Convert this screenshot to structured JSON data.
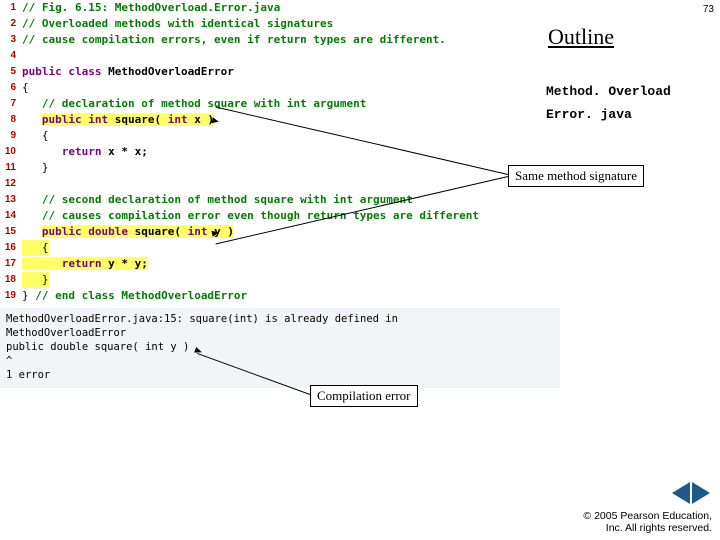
{
  "page_number": "73",
  "outline": "Outline",
  "label_line1": "Method. Overload",
  "label_line2": "Error. java",
  "callout1": "Same method signature",
  "callout2": "Compilation error",
  "footer_line1": "© 2005 Pearson Education,",
  "footer_line2": "Inc.  All rights reserved.",
  "code": {
    "l1": "// Fig. 6.15: MethodOverload.Error.java",
    "l2": "// Overloaded methods with identical signatures",
    "l3": "// cause compilation errors, even if return types are different.",
    "l4": "",
    "l5_kw": "public class ",
    "l5_id": "MethodOverloadError",
    "l6": "{",
    "l7": "   // declaration of method square with int argument",
    "l8a": "   ",
    "l8b": "public int ",
    "l8c": "square( ",
    "l8d": "int ",
    "l8e": "x )",
    "l9": "   {",
    "l10a": "      ",
    "l10b": "return ",
    "l10c": "x * x;",
    "l11": "   }",
    "l12": "",
    "l13": "   // second declaration of method square with int argument",
    "l14": "   // causes compilation error even though return types are different",
    "l15a": "   ",
    "l15b": "public double ",
    "l15c": "square( ",
    "l15d": "int ",
    "l15e": "y )",
    "l16": "   {",
    "l17a": "      ",
    "l17b": "return ",
    "l17c": "y * y;",
    "l18": "   }",
    "l19a": "} ",
    "l19b": "// end class MethodOverloadError"
  },
  "err": {
    "e1": "MethodOverloadError.java:15: square(int) is already defined in",
    "e2": "MethodOverloadError",
    "e3": "   public double square( int y )",
    "e4": "                 ^",
    "e5": "1 error"
  },
  "linenos": [
    "1",
    "2",
    "3",
    "4",
    "5",
    "6",
    "7",
    "8",
    "9",
    "10",
    "11",
    "12",
    "13",
    "14",
    "15",
    "16",
    "17",
    "18",
    "19"
  ]
}
